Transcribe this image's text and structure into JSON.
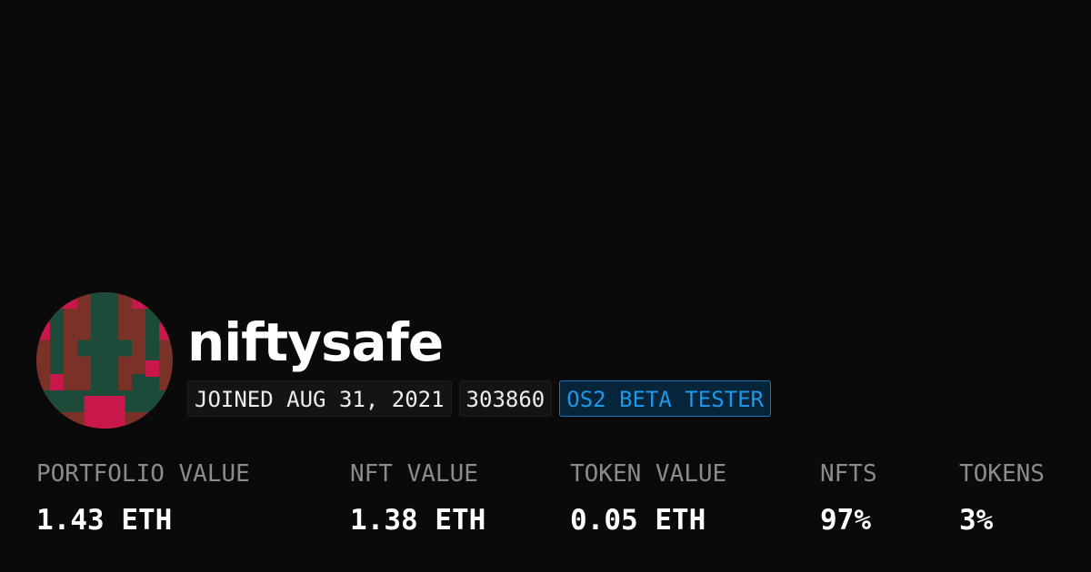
{
  "profile": {
    "username": "niftysafe",
    "avatar_icon": "pixel-art-avatar",
    "avatar_colors": {
      "green": "#1c4b3a",
      "brown": "#7a3128",
      "pink": "#c8174b"
    },
    "badges": {
      "joined": "JOINED AUG 31, 2021",
      "number": "303860",
      "beta": "OS2 BETA TESTER"
    }
  },
  "stats": {
    "portfolio": {
      "label": "PORTFOLIO VALUE",
      "value": "1.43 ETH"
    },
    "nft_value": {
      "label": "NFT VALUE",
      "value": "1.38 ETH"
    },
    "token_value": {
      "label": "TOKEN VALUE",
      "value": "0.05 ETH"
    },
    "nfts": {
      "label": "NFTS",
      "value": "97%"
    },
    "tokens": {
      "label": "TOKENS",
      "value": "3%"
    }
  },
  "colors": {
    "background": "#0a0a0a",
    "accent": "#1e96ea"
  }
}
